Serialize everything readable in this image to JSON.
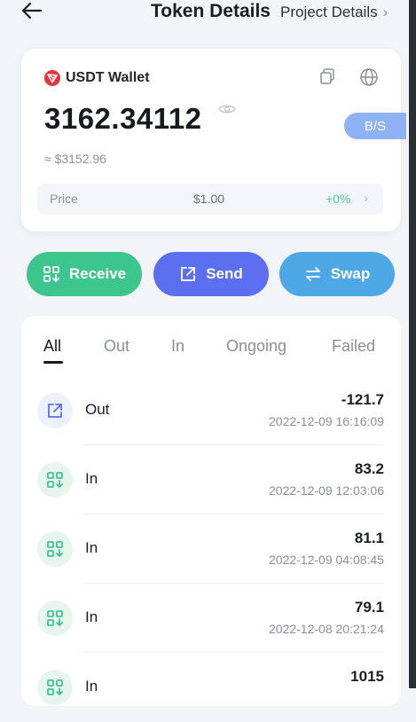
{
  "header": {
    "title": "Token Details",
    "project_link": "Project Details",
    "project_chevron": "›"
  },
  "wallet": {
    "name": "USDT Wallet",
    "balance": "3162.34112",
    "fiat_value": "≈ $3152.96",
    "bs_label": "B/S",
    "price_label": "Price",
    "price_value": "$1.00",
    "price_change": "+0%",
    "price_chevron": "›"
  },
  "actions": {
    "receive": "Receive",
    "send": "Send",
    "swap": "Swap"
  },
  "tabs": [
    {
      "label": "All",
      "active": true
    },
    {
      "label": "Out",
      "active": false
    },
    {
      "label": "In",
      "active": false
    },
    {
      "label": "Ongoing",
      "active": false
    },
    {
      "label": "Failed",
      "active": false
    }
  ],
  "transactions": [
    {
      "type": "Out",
      "icon": "send-out-icon",
      "amount": "-121.7",
      "date": "2022-12-09 16:16:09"
    },
    {
      "type": "In",
      "icon": "receive-in-icon",
      "amount": "83.2",
      "date": "2022-12-09 12:03:06"
    },
    {
      "type": "In",
      "icon": "receive-in-icon",
      "amount": "81.1",
      "date": "2022-12-09 04:08:45"
    },
    {
      "type": "In",
      "icon": "receive-in-icon",
      "amount": "79.1",
      "date": "2022-12-08 20:21:24"
    },
    {
      "type": "In",
      "icon": "receive-in-icon",
      "amount": "1015",
      "date": ""
    }
  ],
  "colors": {
    "receive": "#3dc58e",
    "send": "#5b6ff0",
    "swap": "#4fa8e6",
    "positive_change": "#4bcf95",
    "bs_button": "#8fb1f5",
    "tron_red": "#e8323c"
  }
}
